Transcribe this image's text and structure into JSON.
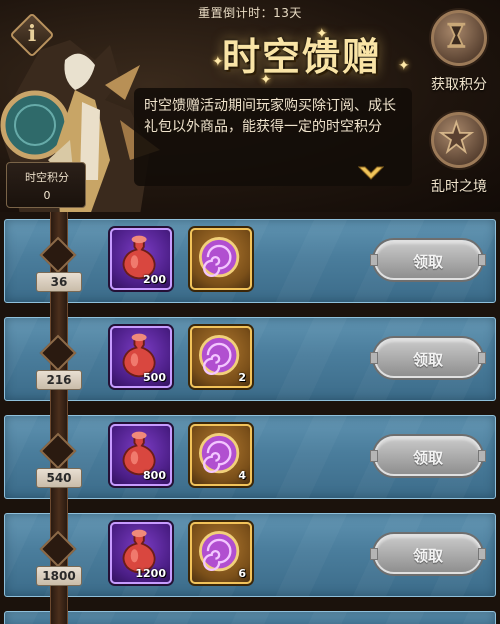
{
  "header": {
    "countdown": "重置倒计时：13天",
    "title": "时空馈赠",
    "description": "时空馈赠活动期间玩家购买除订阅、成长礼包以外商品，能获得一定的时空积分",
    "points_label": "时空积分",
    "points_value": "0",
    "info_icon_glyph": "i"
  },
  "side_buttons": [
    {
      "label": "获取积分",
      "icon": "hourglass-icon"
    },
    {
      "label": "乱时之境",
      "icon": "star-emblem-icon"
    }
  ],
  "rewards": [
    {
      "threshold": "36",
      "items": [
        {
          "name": "potion-icon",
          "qty": "200"
        },
        {
          "name": "vortex-icon",
          "qty": ""
        }
      ],
      "button": "领取"
    },
    {
      "threshold": "216",
      "items": [
        {
          "name": "potion-icon",
          "qty": "500"
        },
        {
          "name": "vortex-icon",
          "qty": "2"
        }
      ],
      "button": "领取"
    },
    {
      "threshold": "540",
      "items": [
        {
          "name": "potion-icon",
          "qty": "800"
        },
        {
          "name": "vortex-icon",
          "qty": "4"
        }
      ],
      "button": "领取"
    },
    {
      "threshold": "1800",
      "items": [
        {
          "name": "potion-icon",
          "qty": "1200"
        },
        {
          "name": "vortex-icon",
          "qty": "6"
        }
      ],
      "button": "领取"
    }
  ],
  "colors": {
    "row_blue": "#4a7d9c",
    "title_gold": "#f9e4a6",
    "button_grey": "#a8a8a8",
    "purple_frame": "#c79bff",
    "gold_frame": "#f2c35a"
  }
}
